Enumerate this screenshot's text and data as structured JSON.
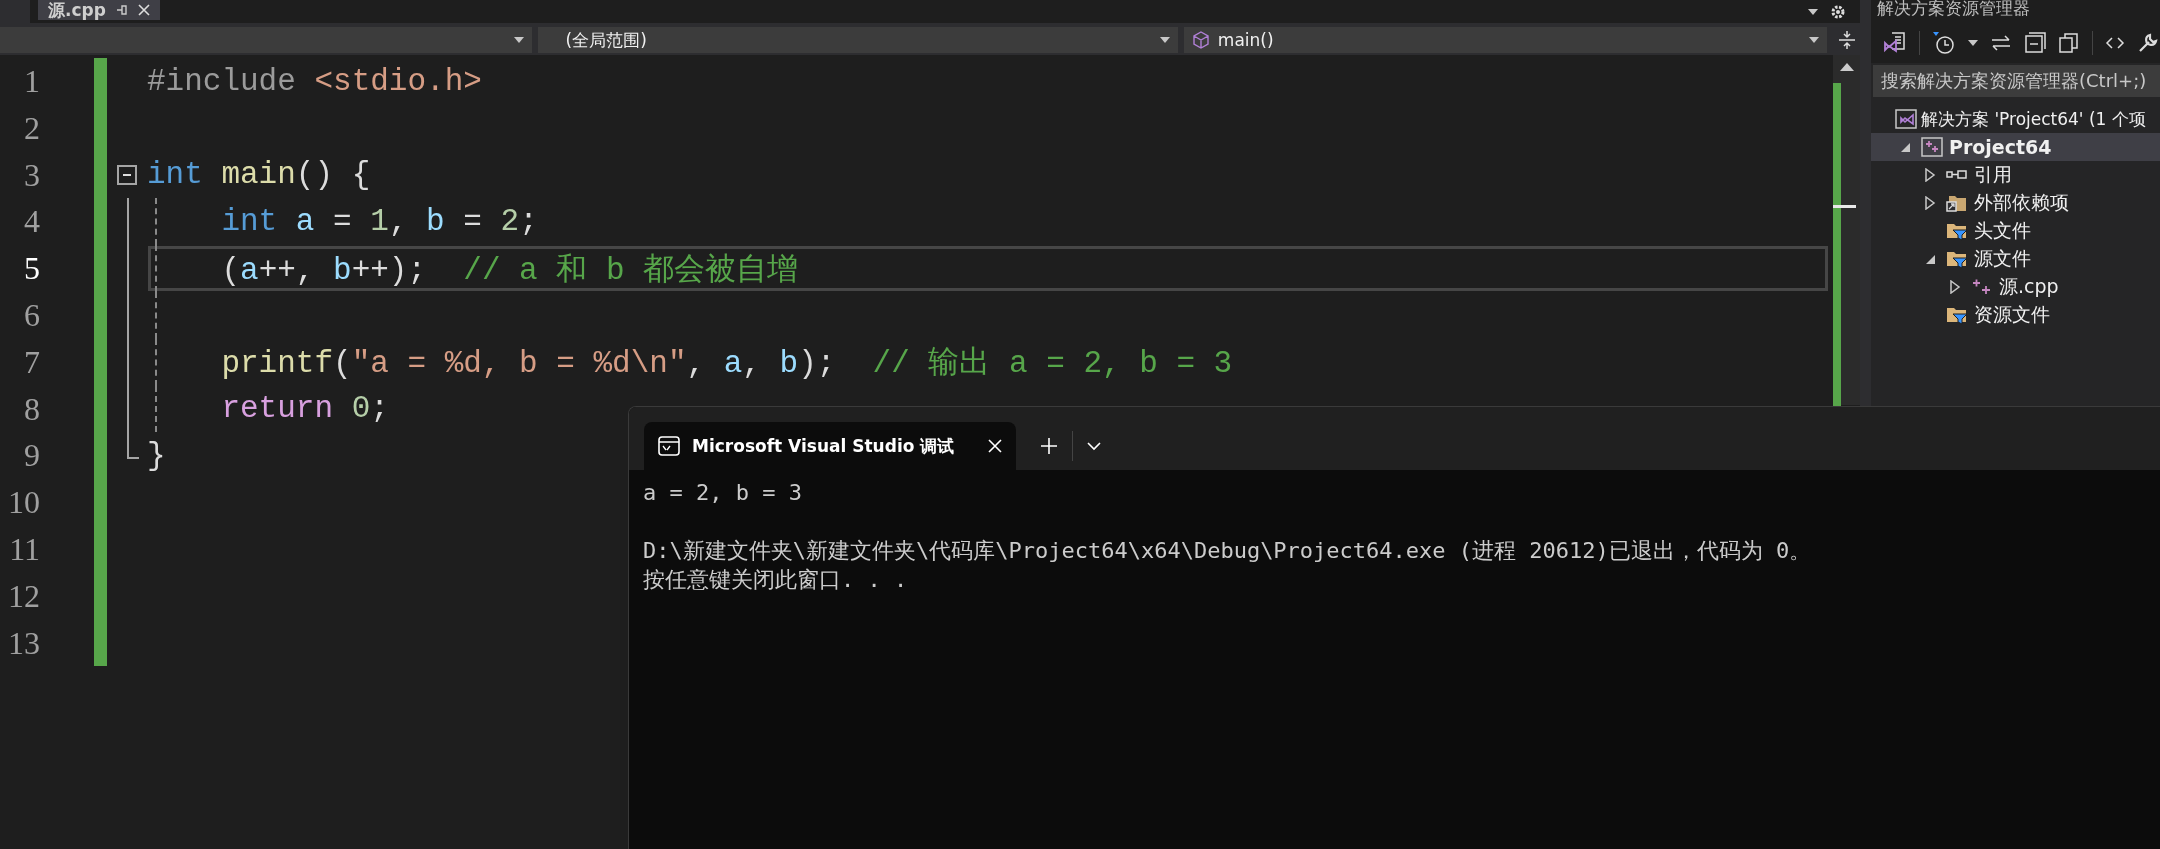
{
  "document_tabs": [
    {
      "label": "源.cpp",
      "selected": true
    }
  ],
  "explorer_title": "解决方案资源管理器",
  "nav_bar": {
    "scope": "(全局范围)",
    "member": "main()"
  },
  "editor": {
    "lines": [
      {
        "number": "1",
        "selected": false,
        "tokens": [
          {
            "kind": "preprocessor",
            "text": "#include"
          },
          {
            "kind": "include",
            "text": " <stdio.h>"
          }
        ]
      },
      {
        "number": "2",
        "selected": false
      },
      {
        "number": "3",
        "selected": false,
        "expanded": true,
        "tokens": [
          {
            "kind": "keyword",
            "text": "int"
          },
          {
            "kind": "function",
            "text": " main"
          },
          {
            "kind": "plain",
            "text": "() {"
          }
        ],
        "children": [
          {
            "number": "4",
            "selected": false,
            "tokens": [
              {
                "kind": "keyword",
                "text": "    int"
              },
              {
                "kind": "variable",
                "text": " a"
              },
              {
                "kind": "plain",
                "text": " = "
              },
              {
                "kind": "number",
                "text": "1"
              },
              {
                "kind": "plain",
                "text": ", "
              },
              {
                "kind": "variable",
                "text": "b"
              },
              {
                "kind": "plain",
                "text": " = "
              },
              {
                "kind": "number",
                "text": "2"
              },
              {
                "kind": "plain",
                "text": ";"
              }
            ]
          },
          {
            "number": "5",
            "selected": true,
            "tokens": [
              {
                "kind": "plain",
                "text": "    ("
              },
              {
                "kind": "variable",
                "text": "a"
              },
              {
                "kind": "plain",
                "text": "++, "
              },
              {
                "kind": "variable",
                "text": "b"
              },
              {
                "kind": "plain",
                "text": "++);  "
              },
              {
                "kind": "comment",
                "text": "// a 和 b 都会被自增"
              }
            ]
          },
          {
            "number": "6",
            "selected": false
          },
          {
            "number": "7",
            "selected": false,
            "tokens": [
              {
                "kind": "function",
                "text": "    printf"
              },
              {
                "kind": "plain",
                "text": "("
              },
              {
                "kind": "string",
                "text": "\"a = %d, b = %d\\n\""
              },
              {
                "kind": "plain",
                "text": ", "
              },
              {
                "kind": "variable",
                "text": "a"
              },
              {
                "kind": "plain",
                "text": ", "
              },
              {
                "kind": "variable",
                "text": "b"
              },
              {
                "kind": "plain",
                "text": ");  "
              },
              {
                "kind": "comment",
                "text": "// 输出 a = 2, b = 3"
              }
            ]
          },
          {
            "number": "8",
            "selected": false,
            "tokens": [
              {
                "kind": "control",
                "text": "    return"
              },
              {
                "kind": "number",
                "text": " 0"
              },
              {
                "kind": "plain",
                "text": ";"
              }
            ]
          },
          {
            "number": "9",
            "selected": false,
            "tokens": [
              {
                "kind": "plain",
                "text": "}"
              }
            ]
          }
        ]
      },
      {
        "number": "10",
        "selected": false
      },
      {
        "number": "11",
        "selected": false
      },
      {
        "number": "12",
        "selected": false
      },
      {
        "number": "13",
        "selected": false
      }
    ]
  },
  "solution_explorer": {
    "search": {
      "placeholder": "搜索解决方案资源管理器(Ctrl+;)"
    },
    "tree": [
      {
        "kind": "solution",
        "label": "解决方案 'Project64' (1 个项",
        "selected": false,
        "children": [
          {
            "kind": "project",
            "label": "Project64",
            "selected": true,
            "expanded": true,
            "children": [
              {
                "kind": "references",
                "label": "引用",
                "selected": false,
                "expanded": false
              },
              {
                "kind": "external",
                "label": "外部依赖项",
                "selected": false,
                "expanded": false
              },
              {
                "kind": "filter",
                "label": "头文件",
                "selected": false
              },
              {
                "kind": "filter",
                "label": "源文件",
                "selected": false,
                "expanded": true,
                "children": [
                  {
                    "kind": "cpp",
                    "label": "源.cpp",
                    "selected": false,
                    "expanded": false
                  }
                ]
              },
              {
                "kind": "filter",
                "label": "资源文件",
                "selected": false
              }
            ]
          }
        ]
      }
    ]
  },
  "console": {
    "tab": {
      "title": "Microsoft Visual Studio 调试"
    },
    "output": [
      {
        "lines": [
          "a = 2, b = 3"
        ]
      },
      {
        "lines": [
          "D:\\新建文件夹\\新建文件夹\\代码库\\Project64\\x64\\Debug\\Project64.exe (进程 20612)已退出，代码为 0。",
          "按任意键关闭此窗口. . ."
        ]
      }
    ]
  }
}
